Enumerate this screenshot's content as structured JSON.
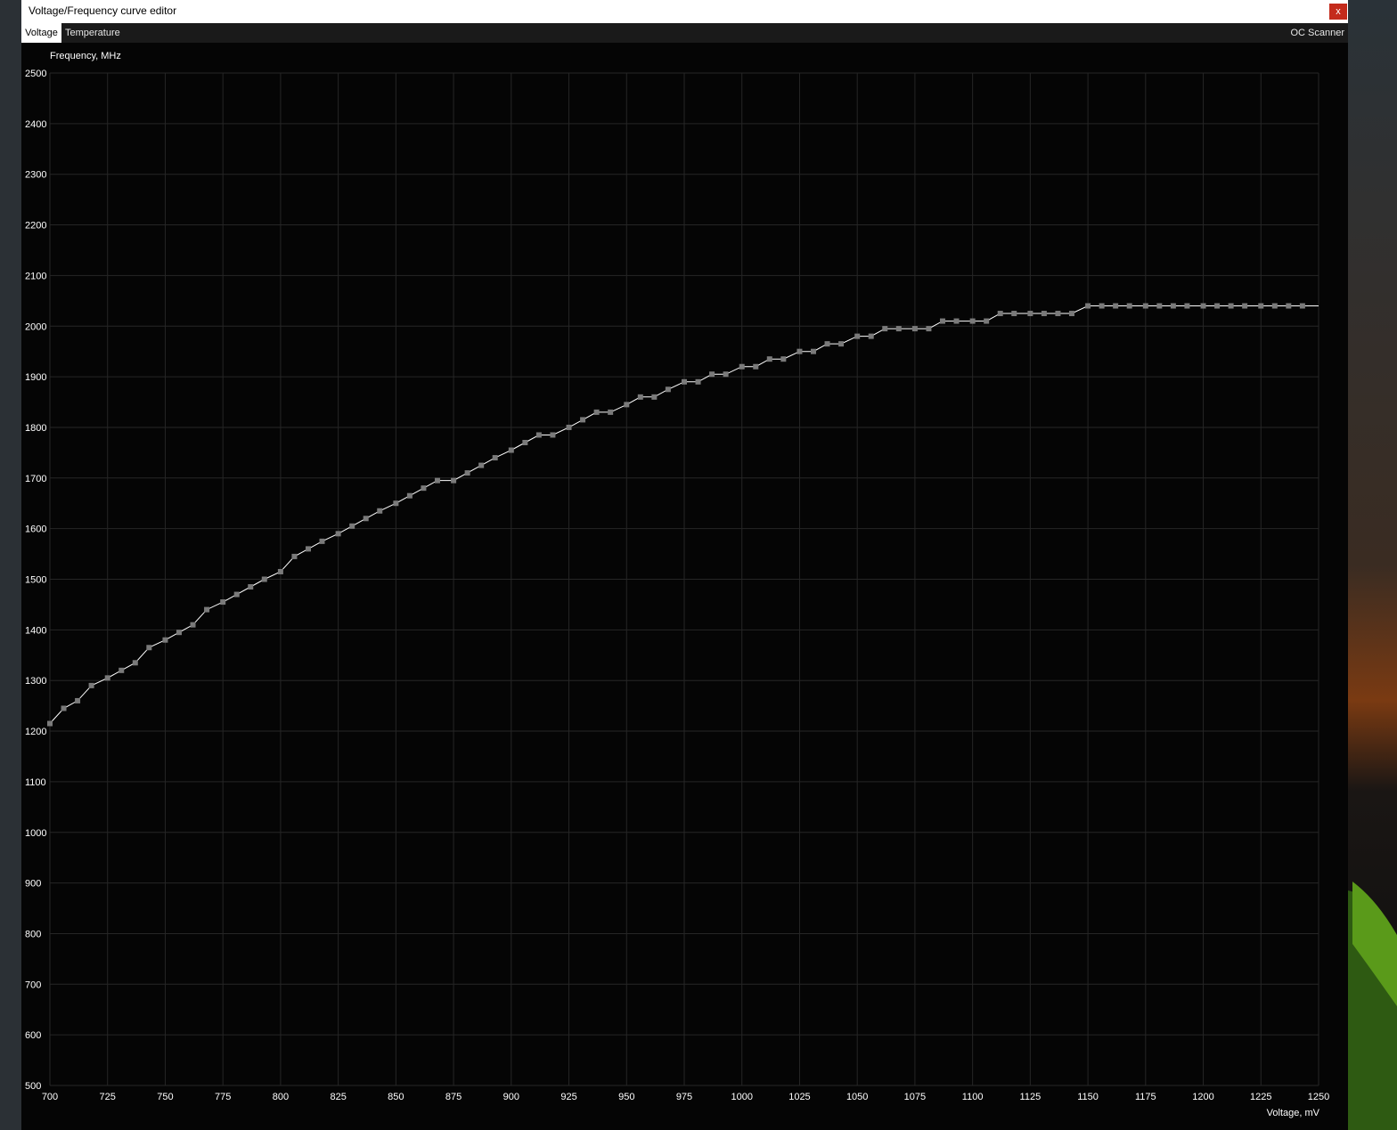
{
  "window": {
    "title": "Voltage/Frequency curve editor",
    "close_label": "x"
  },
  "tabs": [
    {
      "label": "Voltage",
      "active": true
    },
    {
      "label": "Temperature",
      "active": false
    }
  ],
  "oc_scanner_label": "OC Scanner",
  "colors": {
    "background": "#050505",
    "grid": "#262626",
    "curve": "#ffffff",
    "point": "#7a7a7a",
    "text": "#ffffff",
    "close": "#c42b1c"
  },
  "chart_data": {
    "type": "line",
    "ylabel": "Frequency, MHz",
    "xlabel": "Voltage, mV",
    "xlim": [
      700,
      1250
    ],
    "ylim": [
      500,
      2500
    ],
    "x_ticks": [
      700,
      725,
      750,
      775,
      800,
      825,
      850,
      875,
      900,
      925,
      950,
      975,
      1000,
      1025,
      1050,
      1075,
      1100,
      1125,
      1150,
      1175,
      1200,
      1225,
      1250
    ],
    "y_ticks": [
      500,
      600,
      700,
      800,
      900,
      1000,
      1100,
      1200,
      1300,
      1400,
      1500,
      1600,
      1700,
      1800,
      1900,
      2000,
      2100,
      2200,
      2300,
      2400,
      2500
    ],
    "grid": true,
    "series": [
      {
        "x": [
          700,
          706,
          712,
          718,
          725,
          731,
          737,
          743,
          750,
          756,
          762,
          768,
          775,
          781,
          787,
          793,
          800,
          806,
          812,
          818,
          825,
          831,
          837,
          843,
          850,
          856,
          862,
          868,
          875,
          881,
          887,
          893,
          900,
          906,
          912,
          918,
          925,
          931,
          937,
          943,
          950,
          956,
          962,
          968,
          975,
          981,
          987,
          993,
          1000,
          1006,
          1012,
          1018,
          1025,
          1031,
          1037,
          1043,
          1050,
          1056,
          1062,
          1068,
          1075,
          1081,
          1087,
          1093,
          1100,
          1106,
          1112,
          1118,
          1125,
          1131,
          1137,
          1143,
          1150,
          1156,
          1162,
          1168,
          1175,
          1181,
          1187,
          1193,
          1200,
          1206,
          1212,
          1218,
          1225,
          1231,
          1237,
          1243
        ],
        "y": [
          1215,
          1245,
          1260,
          1290,
          1305,
          1320,
          1335,
          1365,
          1380,
          1395,
          1410,
          1440,
          1455,
          1470,
          1485,
          1500,
          1515,
          1545,
          1560,
          1575,
          1590,
          1605,
          1620,
          1635,
          1650,
          1665,
          1680,
          1695,
          1695,
          1710,
          1725,
          1740,
          1755,
          1770,
          1785,
          1785,
          1800,
          1815,
          1830,
          1830,
          1845,
          1860,
          1860,
          1875,
          1890,
          1890,
          1905,
          1905,
          1920,
          1920,
          1935,
          1935,
          1950,
          1950,
          1965,
          1965,
          1980,
          1980,
          1995,
          1995,
          1995,
          1995,
          2010,
          2010,
          2010,
          2010,
          2025,
          2025,
          2025,
          2025,
          2025,
          2025,
          2040,
          2040,
          2040,
          2040,
          2040,
          2040,
          2040,
          2040,
          2040,
          2040,
          2040,
          2040,
          2040,
          2040,
          2040,
          2040
        ]
      }
    ]
  }
}
